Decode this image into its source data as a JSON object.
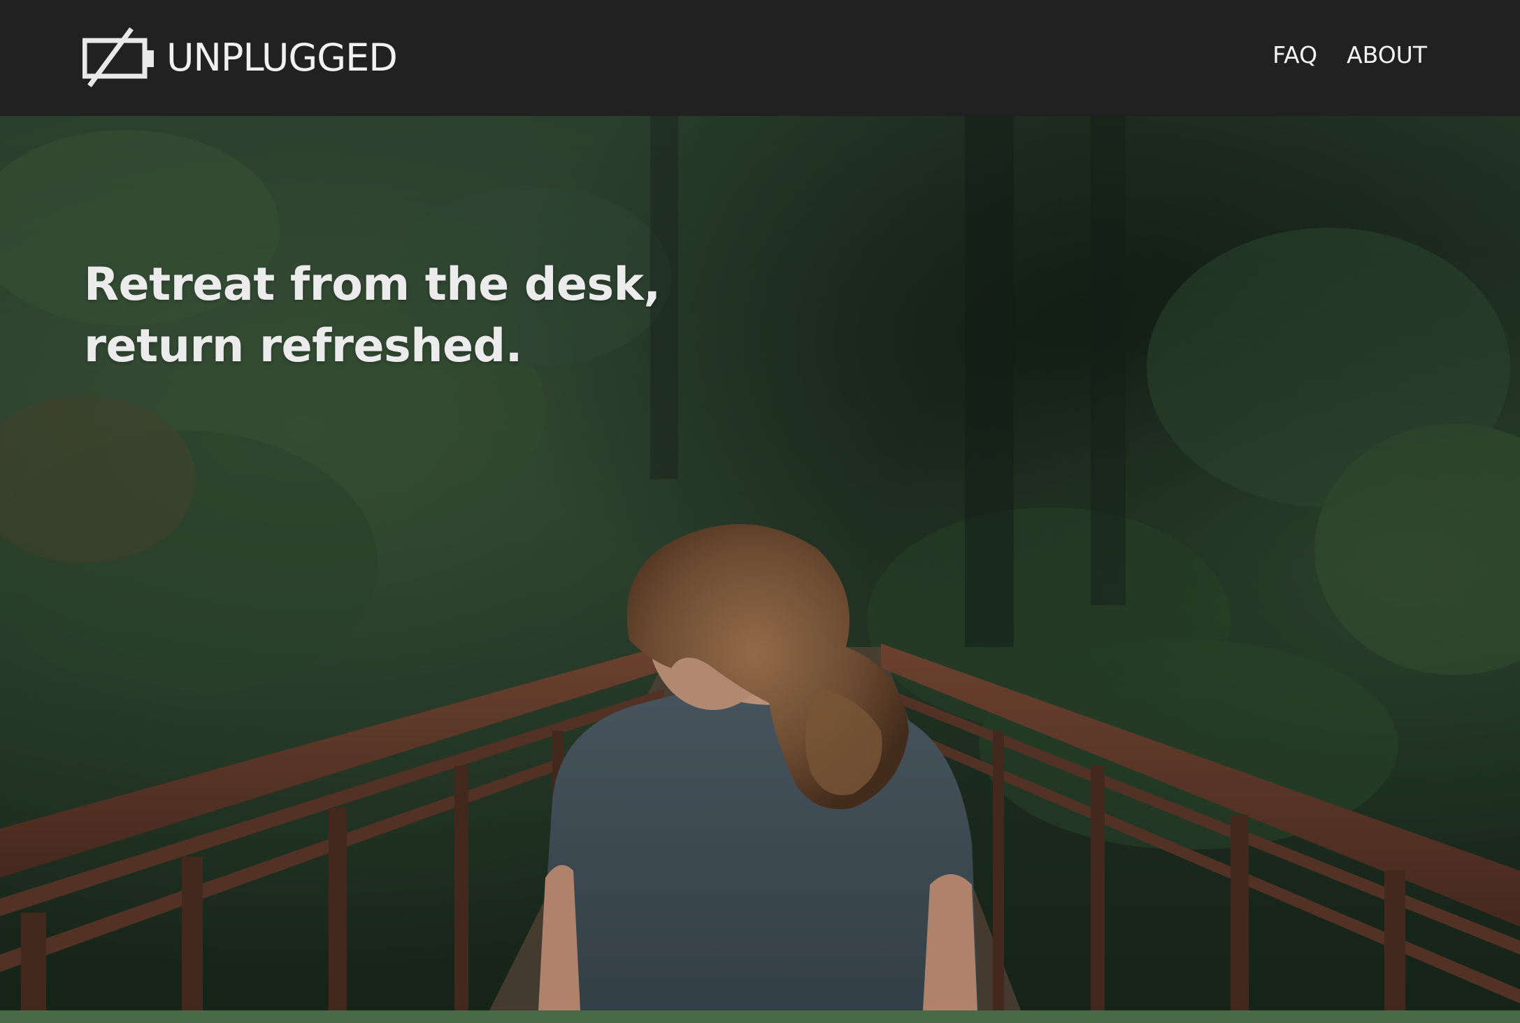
{
  "header": {
    "brand_name": "UNPLUGGED",
    "logo_icon": "battery-off-icon",
    "nav": [
      {
        "label": "FAQ"
      },
      {
        "label": "ABOUT"
      }
    ]
  },
  "hero": {
    "headline": "Retreat from the desk, return refreshed.",
    "image": "woman-on-forest-bridge"
  },
  "colors": {
    "header_bg": "#212121",
    "nav_text": "#f3f3f3",
    "headline_text": "#ececec",
    "footer_strip": "#4a6b48"
  }
}
